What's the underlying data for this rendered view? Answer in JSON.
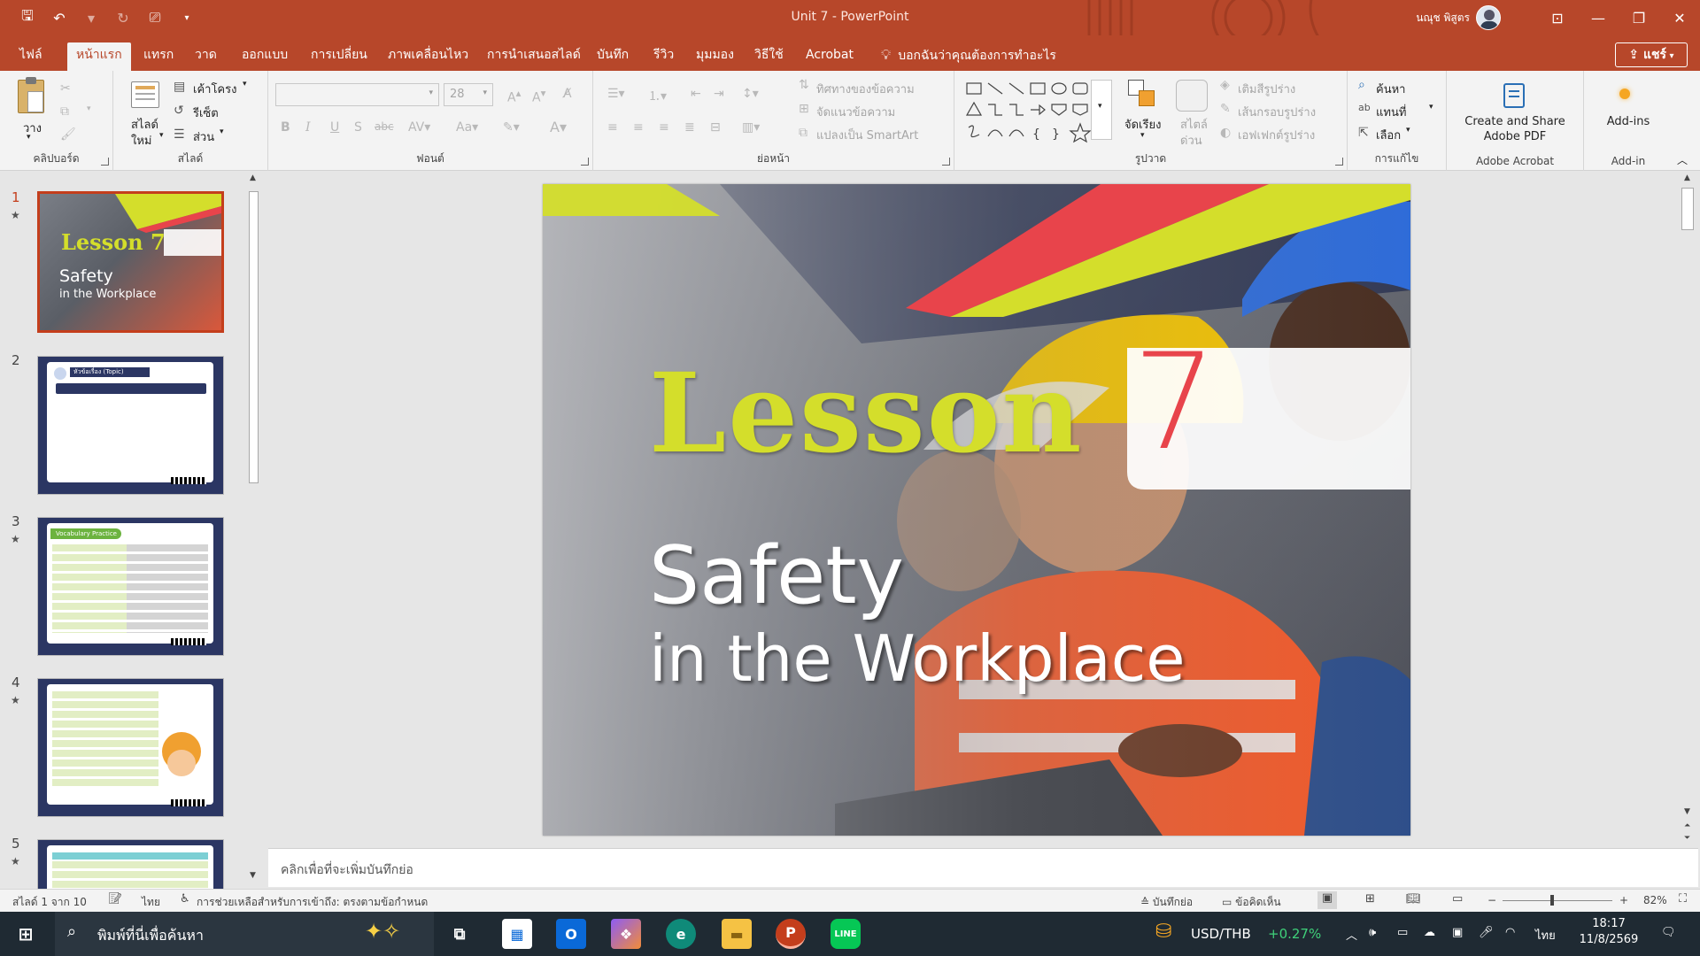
{
  "window": {
    "title": "Unit 7  -  PowerPoint",
    "user": "นณุช พิสูตร"
  },
  "tabs": [
    "ไฟล์",
    "หน้าแรก",
    "แทรก",
    "วาด",
    "ออกแบบ",
    "การเปลี่ยน",
    "ภาพเคลื่อนไหว",
    "การนำเสนอสไลด์",
    "บันทึก",
    "รีวิว",
    "มุมมอง",
    "วิธีใช้",
    "Acrobat"
  ],
  "tell_me": "บอกฉันว่าคุณต้องการทำอะไร",
  "share_label": "แชร์",
  "ribbon": {
    "clipboard": {
      "label": "คลิปบอร์ด",
      "paste": "วาง"
    },
    "slides": {
      "label": "สไลด์",
      "new_slide": "สไลด์",
      "new_slide2": "ใหม่",
      "layout": "เค้าโครง",
      "reset": "รีเซ็ต",
      "section": "ส่วน"
    },
    "font": {
      "label": "ฟอนต์",
      "size": "28"
    },
    "paragraph": {
      "label": "ย่อหน้า",
      "text_direction": "ทิศทางของข้อความ",
      "align_text": "จัดแนวข้อความ",
      "smartart": "แปลงเป็น SmartArt"
    },
    "drawing": {
      "label": "รูปวาด",
      "arrange": "จัดเรียง",
      "quick_styles": "สไตล์",
      "quick_styles2": "ด่วน",
      "fill": "เติมสีรูปร่าง",
      "outline": "เส้นกรอบรูปร่าง",
      "effects": "เอฟเฟกต์รูปร่าง"
    },
    "editing": {
      "label": "การแก้ไข",
      "find": "ค้นหา",
      "replace": "แทนที่",
      "select": "เลือก"
    },
    "acrobat": {
      "label": "Adobe Acrobat",
      "create": "Create and Share",
      "create2": "Adobe PDF"
    },
    "addins": {
      "label": "Add-in",
      "button": "Add-ins"
    }
  },
  "thumbnails": [
    {
      "num": "1",
      "star": "★",
      "title": "Lesson 7",
      "sub1": "Safety",
      "sub2": "in the Workplace"
    },
    {
      "num": "2",
      "star": "",
      "heading": "หัวข้อเรื่อง (Topic)"
    },
    {
      "num": "3",
      "star": "★",
      "heading": "Vocabulary Practice"
    },
    {
      "num": "4",
      "star": "★"
    },
    {
      "num": "5",
      "star": "★"
    }
  ],
  "slide": {
    "title": "Lesson",
    "number": "7",
    "line1": "Safety",
    "line2": "in the Workplace"
  },
  "notes_placeholder": "คลิกเพื่อที่จะเพิ่มบันทึกย่อ",
  "status": {
    "slide_of": "สไลด์ 1 จาก 10",
    "language": "ไทย",
    "accessibility": "การช่วยเหลือสำหรับการเข้าถึง: ตรงตามข้อกำหนด",
    "notes": "บันทึกย่อ",
    "comments": "ข้อคิดเห็น",
    "zoom": "82%",
    "zoom_fraction": 0.45
  },
  "taskbar": {
    "search_placeholder": "พิมพ์ที่นี่เพื่อค้นหา",
    "ticker": "USD/THB",
    "ticker_change": "+0.27%",
    "lang": "ไทย",
    "time": "18:17",
    "date": "11/8/2569"
  },
  "colors": {
    "accent": "#b7472a",
    "lime": "#d4de2b",
    "red": "#e8444b"
  }
}
